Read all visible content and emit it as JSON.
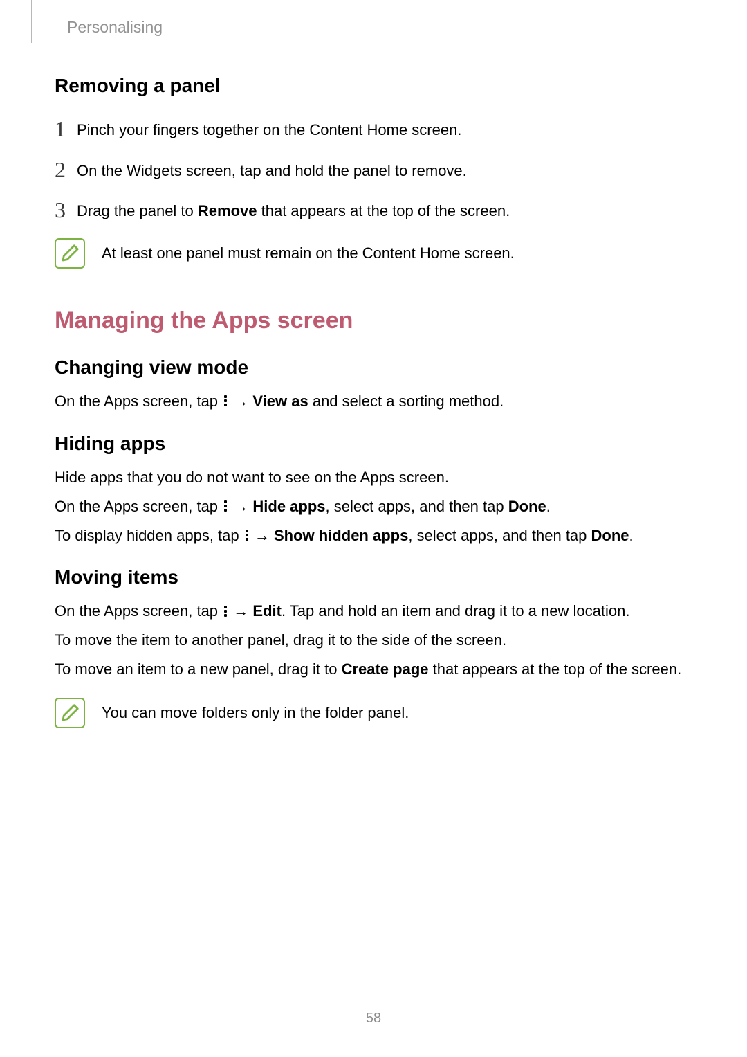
{
  "breadcrumb": "Personalising",
  "page_number": "58",
  "section1": {
    "heading": "Removing a panel",
    "steps": [
      {
        "num": "1",
        "text": "Pinch your fingers together on the Content Home screen."
      },
      {
        "num": "2",
        "text": "On the Widgets screen, tap and hold the panel to remove."
      }
    ],
    "step3": {
      "num": "3",
      "pre": "Drag the panel to ",
      "bold": "Remove",
      "post": " that appears at the top of the screen."
    },
    "note": "At least one panel must remain on the Content Home screen."
  },
  "section2": {
    "heading": "Managing the Apps screen",
    "sub1": {
      "heading": "Changing view mode",
      "p1_pre": "On the Apps screen, tap ",
      "arrow": " → ",
      "p1_bold": "View as",
      "p1_post": " and select a sorting method."
    },
    "sub2": {
      "heading": "Hiding apps",
      "p1": "Hide apps that you do not want to see on the Apps screen.",
      "p2_pre": "On the Apps screen, tap ",
      "p2_bold1": "Hide apps",
      "p2_mid": ", select apps, and then tap ",
      "p2_bold2": "Done",
      "p2_post": ".",
      "p3_pre": "To display hidden apps, tap ",
      "p3_bold1": "Show hidden apps",
      "p3_mid": ", select apps, and then tap ",
      "p3_bold2": "Done",
      "p3_post": "."
    },
    "sub3": {
      "heading": "Moving items",
      "p1_pre": "On the Apps screen, tap ",
      "p1_bold": "Edit",
      "p1_post": ". Tap and hold an item and drag it to a new location.",
      "p2": "To move the item to another panel, drag it to the side of the screen.",
      "p3_pre": "To move an item to a new panel, drag it to ",
      "p3_bold": "Create page",
      "p3_post": " that appears at the top of the screen.",
      "note": "You can move folders only in the folder panel."
    }
  }
}
